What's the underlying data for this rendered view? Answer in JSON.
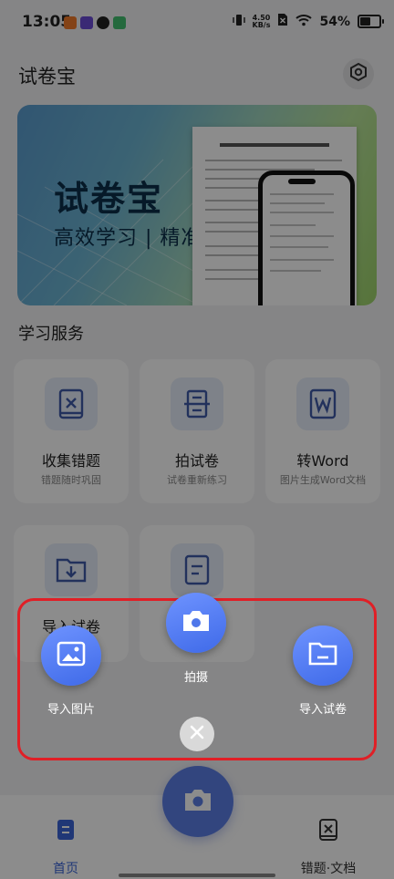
{
  "status_bar": {
    "time": "13:05",
    "net_speed": "4.50",
    "net_unit": "KB/s",
    "battery": "54%"
  },
  "header": {
    "title": "试卷宝"
  },
  "banner": {
    "title": "试卷宝",
    "subtitle": "高效学习 | 精准提分"
  },
  "section": {
    "title": "学习服务"
  },
  "tiles": [
    {
      "title": "收集错题",
      "subtitle": "错题随时巩固",
      "icon": "mistake-book-icon"
    },
    {
      "title": "拍试卷",
      "subtitle": "试卷重新练习",
      "icon": "scan-paper-icon"
    },
    {
      "title": "转Word",
      "subtitle": "图片生成Word文档",
      "icon": "word-icon"
    },
    {
      "title": "导入试卷",
      "subtitle": "",
      "icon": "folder-download-icon"
    },
    {
      "title": "",
      "subtitle": "",
      "icon": "document-icon"
    }
  ],
  "popup": {
    "import_image": "导入图片",
    "capture": "拍摄",
    "import_paper": "导入试卷"
  },
  "nav": {
    "home": "首页",
    "mistakes": "错题·文档"
  },
  "colors": {
    "accent": "#4a72ea",
    "highlight": "#e01f26"
  }
}
